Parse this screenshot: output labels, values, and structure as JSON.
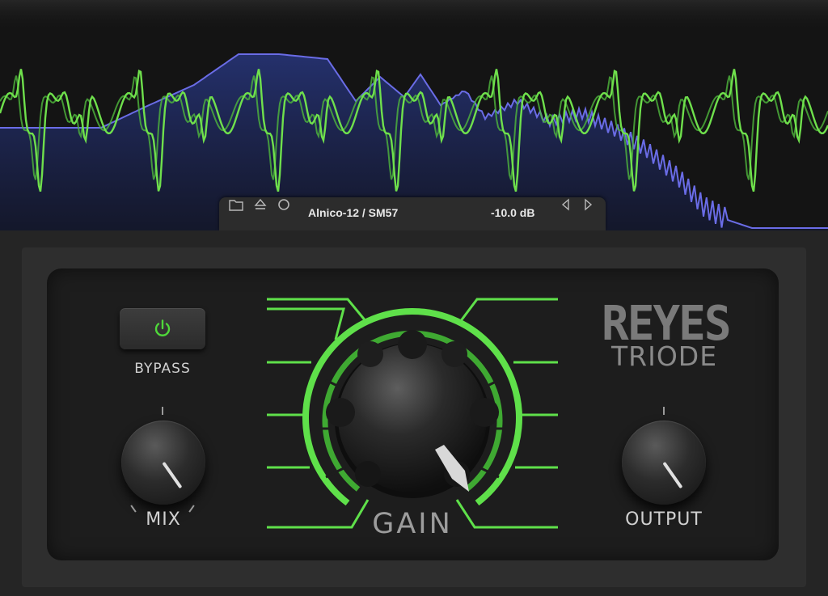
{
  "analyzer": {
    "preset": "Alnico-12 / SM57",
    "level": "-10.0 dB",
    "colors": {
      "waveform": "#6fe04c",
      "spectrum": "#6a6ce6"
    }
  },
  "toolbar": {
    "icons": [
      "folder-icon",
      "eject-icon",
      "circle-icon",
      "prev-arrow-icon",
      "next-arrow-icon"
    ]
  },
  "controls": {
    "bypass_label": "BYPASS",
    "mix_label": "MIX",
    "gain_label": "GAIN",
    "output_label": "OUTPUT",
    "bypass_color": "#4fd83a",
    "gain_color": "#5fe04a"
  },
  "logo": {
    "line1": "REYES",
    "line2": "TRIODE"
  }
}
